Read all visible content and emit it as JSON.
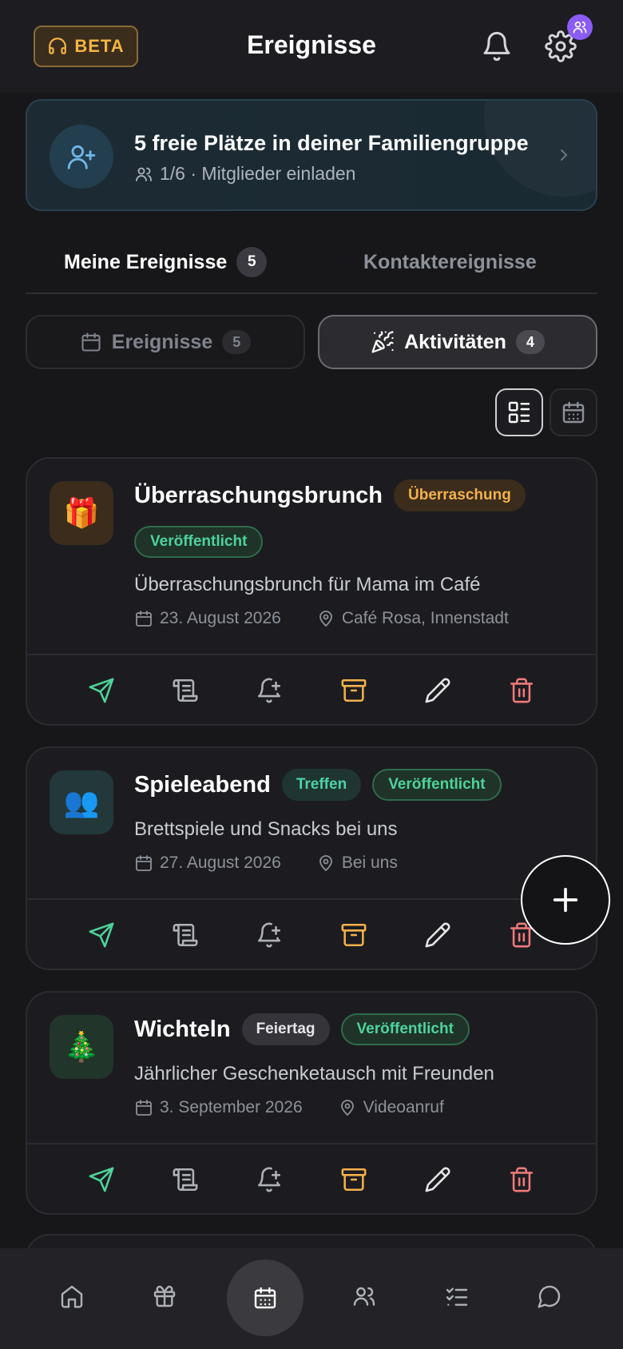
{
  "header": {
    "beta_label": "BETA",
    "title": "Ereignisse",
    "icons": [
      "headset-icon",
      "bell-icon",
      "gear-icon",
      "users-icon"
    ]
  },
  "banner": {
    "title": "5 freie Plätze in deiner Familiengruppe",
    "subtitle": "1/6 · Mitglieder einladen"
  },
  "tabs": [
    {
      "label": "Meine Ereignisse",
      "count": "5",
      "active": true
    },
    {
      "label": "Kontaktereignisse",
      "active": false
    }
  ],
  "segments": [
    {
      "label": "Ereignisse",
      "count": "5",
      "active": false
    },
    {
      "label": "Aktivitäten",
      "count": "4",
      "active": true
    }
  ],
  "cards": [
    {
      "emoji": "🎁",
      "title": "Überraschungsbrunch",
      "tag": "Überraschung",
      "status": "Veröffentlicht",
      "description": "Überraschungsbrunch für Mama im Café",
      "date": "23. August 2026",
      "location": "Café Rosa, Innenstadt"
    },
    {
      "emoji": "👥",
      "title": "Spieleabend",
      "tag": "Treffen",
      "status": "Veröffentlicht",
      "description": "Brettspiele und Snacks bei uns",
      "date": "27. August 2026",
      "location": "Bei uns"
    },
    {
      "emoji": "🎄",
      "title": "Wichteln",
      "tag": "Feiertag",
      "status": "Veröffentlicht",
      "description": "Jährlicher Geschenketausch mit Freunden",
      "date": "3. September 2026",
      "location": "Videoanruf"
    }
  ],
  "colors": {
    "accent_green": "#4ed39a",
    "accent_amber": "#f3b14b",
    "accent_red": "#f07a7a",
    "badge_purple": "#8b5cf6"
  },
  "bottom_nav": [
    "home-icon",
    "gift-icon",
    "calendar-icon",
    "users-icon",
    "checklist-icon",
    "chat-icon"
  ]
}
